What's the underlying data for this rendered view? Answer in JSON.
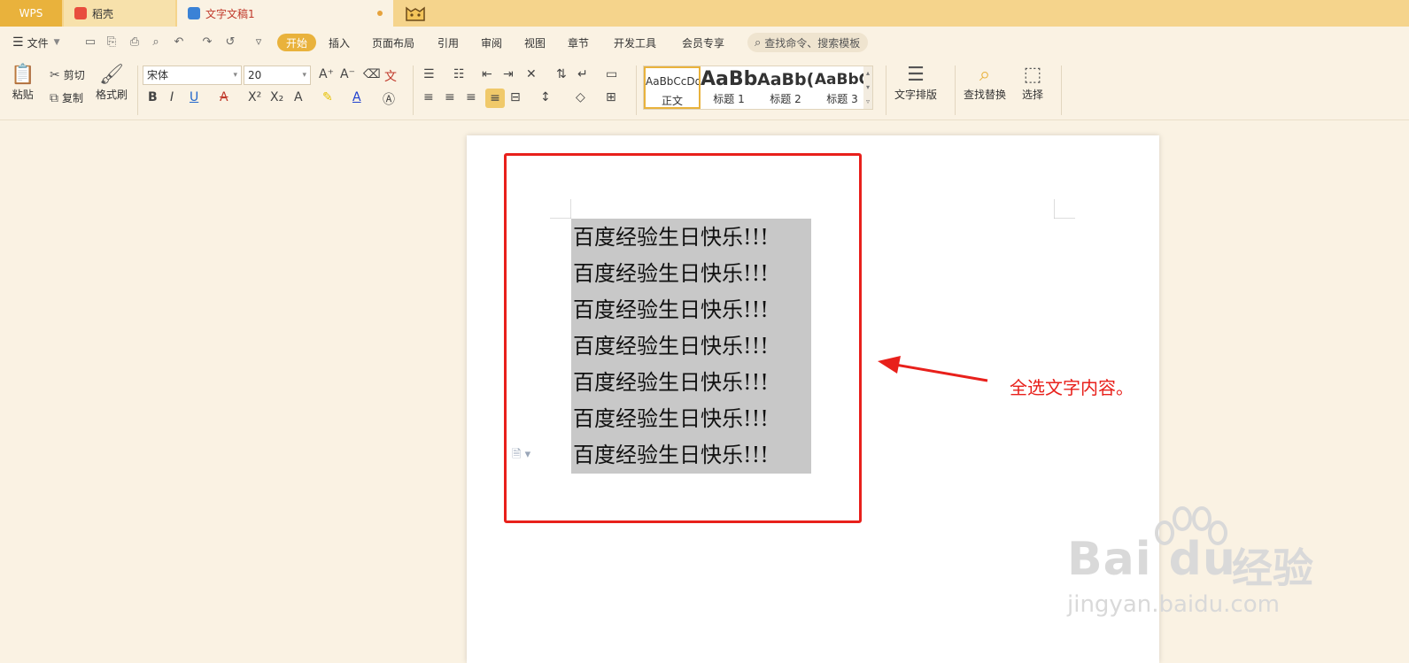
{
  "tabs": {
    "wps": "WPS",
    "docer": "稻壳",
    "document": "文字文稿1"
  },
  "menu": {
    "file": "文件",
    "items": [
      "开始",
      "插入",
      "页面布局",
      "引用",
      "审阅",
      "视图",
      "章节",
      "开发工具",
      "会员专享"
    ],
    "search_placeholder": "查找命令、搜索模板"
  },
  "ribbon": {
    "paste": "粘贴",
    "cut": "剪切",
    "copy": "复制",
    "format_painter": "格式刷",
    "font_name": "宋体",
    "font_size": "20",
    "styles": [
      {
        "preview": "AaBbCcDd",
        "name": "正文"
      },
      {
        "preview": "AaBb",
        "name": "标题 1"
      },
      {
        "preview": "AaBb(",
        "name": "标题 2"
      },
      {
        "preview": "AaBbC",
        "name": "标题 3"
      }
    ],
    "text_layout": "文字排版",
    "find_replace": "查找替换",
    "select": "选择"
  },
  "document": {
    "lines": [
      "百度经验生日快乐!!!",
      "百度经验生日快乐!!!",
      "百度经验生日快乐!!!",
      "百度经验生日快乐!!!",
      "百度经验生日快乐!!!",
      "百度经验生日快乐!!!",
      "百度经验生日快乐!!!"
    ]
  },
  "annotation": "全选文字内容。",
  "watermark": {
    "logo": "Bai du",
    "cn": "经验",
    "url": "jingyan.baidu.com"
  },
  "colors": {
    "accent": "#e9b23c",
    "annotation_red": "#e8201b"
  }
}
